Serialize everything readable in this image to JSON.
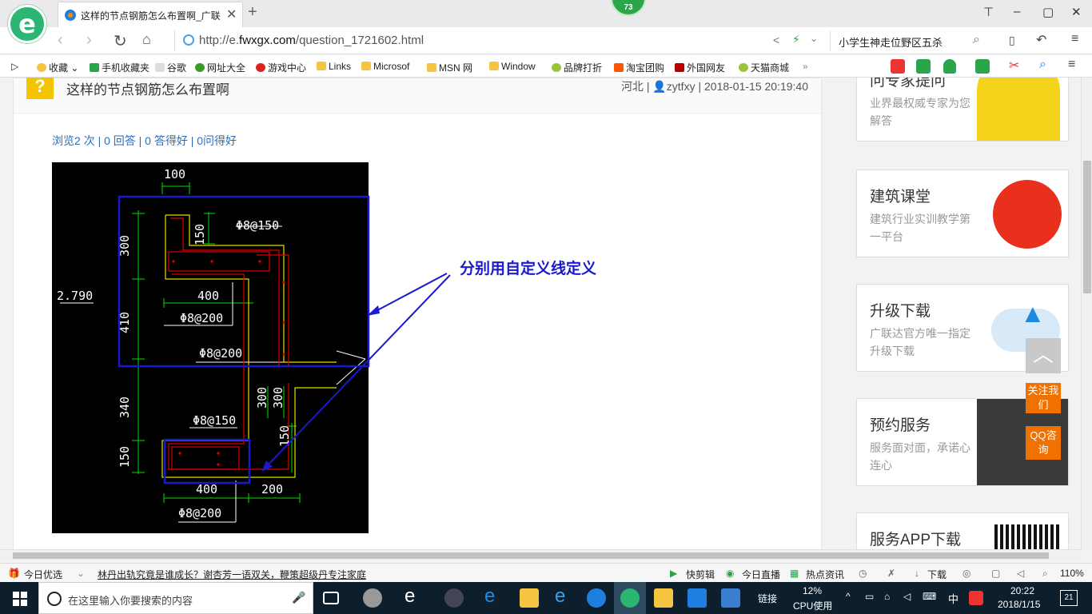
{
  "browser": {
    "tab_title": "这样的节点钢筋怎么布置啊_广联",
    "badge_count": "73",
    "url_prefix": "http://e.",
    "url_domain": "fwxgx.com",
    "url_path": "/question_1721602.html",
    "search_text": "小学生神走位野区五杀",
    "bookmarks": [
      "收藏",
      "手机收藏夹",
      "谷歌",
      "网址大全",
      "游戏中心",
      "Links",
      "Microsof",
      "MSN 网",
      "Window",
      "品牌打折",
      "淘宝团购",
      "外国网友",
      "天猫商城"
    ]
  },
  "question": {
    "title": "这样的节点钢筋怎么布置啊",
    "region": "河北",
    "user": "zytfxy",
    "datetime": "2018-01-15 20:19:40",
    "stats": "浏览2 次 | 0 回答 | 0 答得好 | 0问得好"
  },
  "drawing": {
    "labels": {
      "dim_100": "100",
      "dim_300_a": "300",
      "dim_150_a": "150",
      "rebar_a": "Φ8@150",
      "dim_400_a": "400",
      "rebar_b": "Φ8@200",
      "elev": "2.790",
      "dim_410": "410",
      "rebar_c": "Φ8@200",
      "dim_300_b": "300",
      "dim_300_c": "300",
      "dim_340": "340",
      "rebar_d": "Φ8@150",
      "dim_150_b": "150",
      "dim_150_c": "150",
      "dim_400_b": "400",
      "dim_200": "200",
      "rebar_e": "Φ8@200"
    },
    "annotation": "分别用自定义线定义"
  },
  "sidebar": {
    "cards": [
      {
        "title": "问专家提问",
        "desc": "业界最权威专家为您解答"
      },
      {
        "title": "建筑课堂",
        "desc": "建筑行业实训教学第一平台"
      },
      {
        "title": "升级下载",
        "desc": "广联达官方唯一指定升级下载"
      },
      {
        "title": "预约服务",
        "desc": "服务面对面，承诺心连心"
      },
      {
        "title": "服务APP下载",
        "desc": ""
      }
    ],
    "follow": "关注我们",
    "qq": "QQ咨询"
  },
  "statusbar": {
    "today_pick": "今日优选",
    "headline": "林丹出轨究竟是谁成长？谢杏芳一语双关，鞭策超级丹专注家庭",
    "quick_cut": "快剪辑",
    "live": "今日直播",
    "hot": "热点资讯",
    "download": "下载",
    "zoom": "110%"
  },
  "taskbar": {
    "search_placeholder": "在这里输入你要搜索的内容",
    "links": "链接",
    "cpu_percent": "12%",
    "cpu_label": "CPU使用",
    "ime": "中",
    "time": "20:22",
    "date": "2018/1/15",
    "notif_count": "21"
  },
  "colors": {
    "annotation_blue": "#1a1acc",
    "cad_green": "#00e000",
    "cad_red": "#e00000",
    "cad_yellow": "#e0e000",
    "accent_orange": "#f07000"
  }
}
